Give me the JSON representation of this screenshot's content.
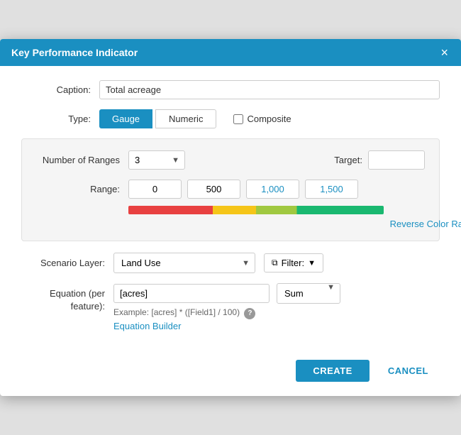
{
  "dialog": {
    "title": "Key Performance Indicator",
    "close_label": "×"
  },
  "form": {
    "caption_label": "Caption:",
    "caption_value": "Total acreage",
    "type_label": "Type:",
    "btn_gauge": "Gauge",
    "btn_numeric": "Numeric",
    "composite_label": "Composite"
  },
  "ranges": {
    "num_ranges_label": "Number of Ranges",
    "num_ranges_value": "3",
    "target_label": "Target:",
    "target_value": "",
    "range_label": "Range:",
    "range_values": [
      "0",
      "500",
      "1,000",
      "1,500"
    ],
    "reverse_ramp_label": "Reverse Color Ramp"
  },
  "scenario": {
    "scenario_layer_label": "Scenario Layer:",
    "layer_value": "Land Use",
    "filter_label": "Filter:",
    "equation_label": "Equation (per feature):",
    "equation_value": "[acres]",
    "example_text": "Example: [acres] * ([Field1] / 100)",
    "equation_builder_label": "Equation Builder",
    "sum_value": "Sum"
  },
  "footer": {
    "create_label": "CREATE",
    "cancel_label": "CANCEL"
  },
  "colors": {
    "accent": "#1a8fc1",
    "ramp_red": "#e84040",
    "ramp_yellow": "#f5c518",
    "ramp_lime": "#a0c840",
    "ramp_green": "#1ab870"
  }
}
